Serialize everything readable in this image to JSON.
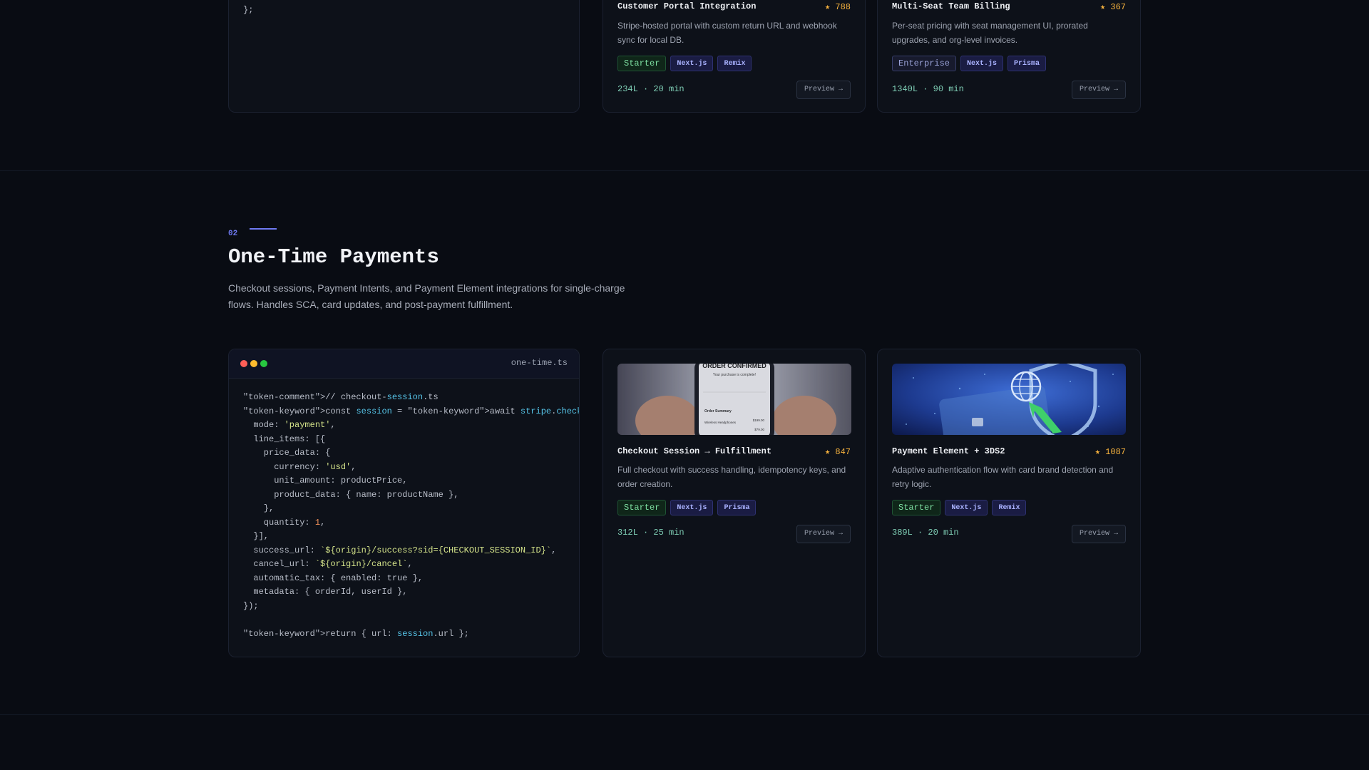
{
  "top_section": {
    "code_tail": "};",
    "cards": [
      {
        "title": "Customer Portal Integration",
        "stars": "788",
        "description": "Stripe-hosted portal with custom return URL and webhook sync for local DB.",
        "tier": "Starter",
        "tech": [
          "Next.js",
          "Remix"
        ],
        "lines": "234",
        "duration": "20 min",
        "preview": "Preview →"
      },
      {
        "title": "Multi-Seat Team Billing",
        "stars": "367",
        "description": "Per-seat pricing with seat management UI, prorated upgrades, and org-level invoices.",
        "tier": "Enterprise",
        "tech": [
          "Next.js",
          "Prisma"
        ],
        "lines": "1340",
        "duration": "90 min",
        "preview": "Preview →"
      }
    ]
  },
  "section": {
    "number": "02",
    "title": "One-Time Payments",
    "description": "Checkout sessions, Payment Intents, and Payment Element integrations for single-charge flows. Handles SCA, card updates, and post-payment fulfillment."
  },
  "code_window": {
    "filename": "one-time.ts"
  },
  "cards": [
    {
      "title": "Checkout Session → Fulfillment",
      "stars": "847",
      "description": "Full checkout with success handling, idempotency keys, and order creation.",
      "tier": "Starter",
      "tech": [
        "Next.js",
        "Prisma"
      ],
      "lines": "312",
      "duration": "25 min",
      "preview": "Preview →",
      "thumb_text": {
        "heading": "ORDER CONFIRMED",
        "sub": "Your purchase is complete!",
        "summary": "Order Summary",
        "item": "Wireless Headphones",
        "price1": "$199.00",
        "price2": "$79.00"
      }
    },
    {
      "title": "Payment Element + 3DS2",
      "stars": "1087",
      "description": "Adaptive authentication flow with card brand detection and retry logic.",
      "tier": "Starter",
      "tech": [
        "Next.js",
        "Remix"
      ],
      "lines": "389",
      "duration": "20 min",
      "preview": "Preview →"
    }
  ],
  "icons": {
    "star": "star-icon",
    "arrow": "arrow-right-icon"
  },
  "colors": {
    "accent": "#6f7af2",
    "star": "#f6b23e",
    "starter": "#7ee0a2"
  }
}
